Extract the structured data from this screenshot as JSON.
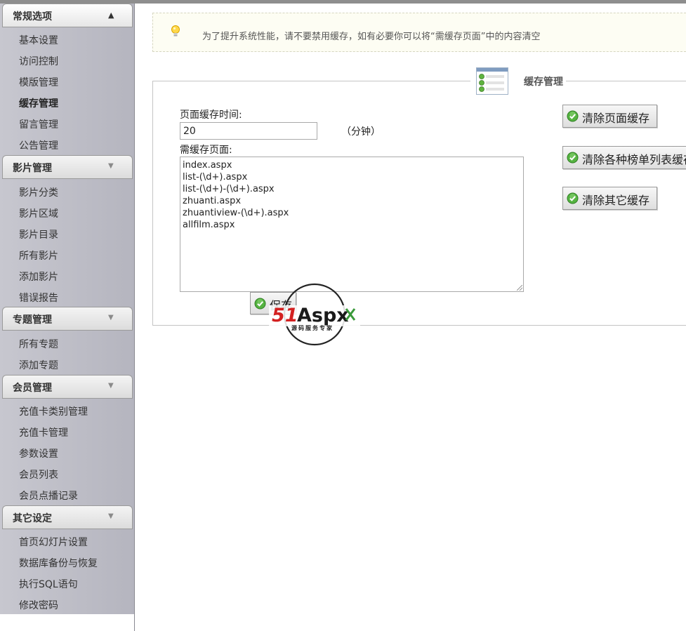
{
  "sidebar": {
    "sections": [
      {
        "title": "常规选项",
        "expanded": true,
        "items": [
          "基本设置",
          "访问控制",
          "模版管理",
          "缓存管理",
          "留言管理",
          "公告管理"
        ],
        "current": "缓存管理"
      },
      {
        "title": "影片管理",
        "expanded": false,
        "items": [
          "影片分类",
          "影片区域",
          "影片目录",
          "所有影片",
          "添加影片",
          "错误报告"
        ]
      },
      {
        "title": "专题管理",
        "expanded": false,
        "items": [
          "所有专题",
          "添加专题"
        ]
      },
      {
        "title": "会员管理",
        "expanded": false,
        "items": [
          "充值卡类别管理",
          "充值卡管理",
          "参数设置",
          "会员列表",
          "会员点播记录"
        ]
      },
      {
        "title": "其它设定",
        "expanded": false,
        "items": [
          "首页幻灯片设置",
          "数据库备份与恢复",
          "执行SQL语句",
          "修改密码"
        ]
      }
    ]
  },
  "tip": {
    "icon": "lightbulb-icon",
    "text": "为了提升系统性能，请不要禁用缓存，如有必要你可以将“需缓存页面”中的内容清空"
  },
  "cache": {
    "legend": "缓存管理",
    "time_label": "页面缓存时间:",
    "time_value": "20",
    "time_unit": "（分钟）",
    "pages_label": "需缓存页面:",
    "pages": [
      "index.aspx",
      "list-(\\d+).aspx",
      "list-(\\d+)-(\\d+).aspx",
      "zhuanti.aspx",
      "zhuantiview-(\\d+).aspx",
      "allfilm.aspx"
    ],
    "save_label": "保存",
    "buttons": {
      "clear_page": "清除页面缓存",
      "clear_lists": "清除各种榜单列表缓存",
      "clear_other": "清除其它缓存"
    }
  },
  "watermark": {
    "brand": "51Aspx",
    "tagline": "源码服务专家"
  },
  "colors": {
    "ok_green": "#4caf3f",
    "tip_bg": "#fdfdf3",
    "sidebar_bg": "#c0c0ca",
    "watermark_red": "#d32020",
    "watermark_green": "#3a9a3a"
  }
}
